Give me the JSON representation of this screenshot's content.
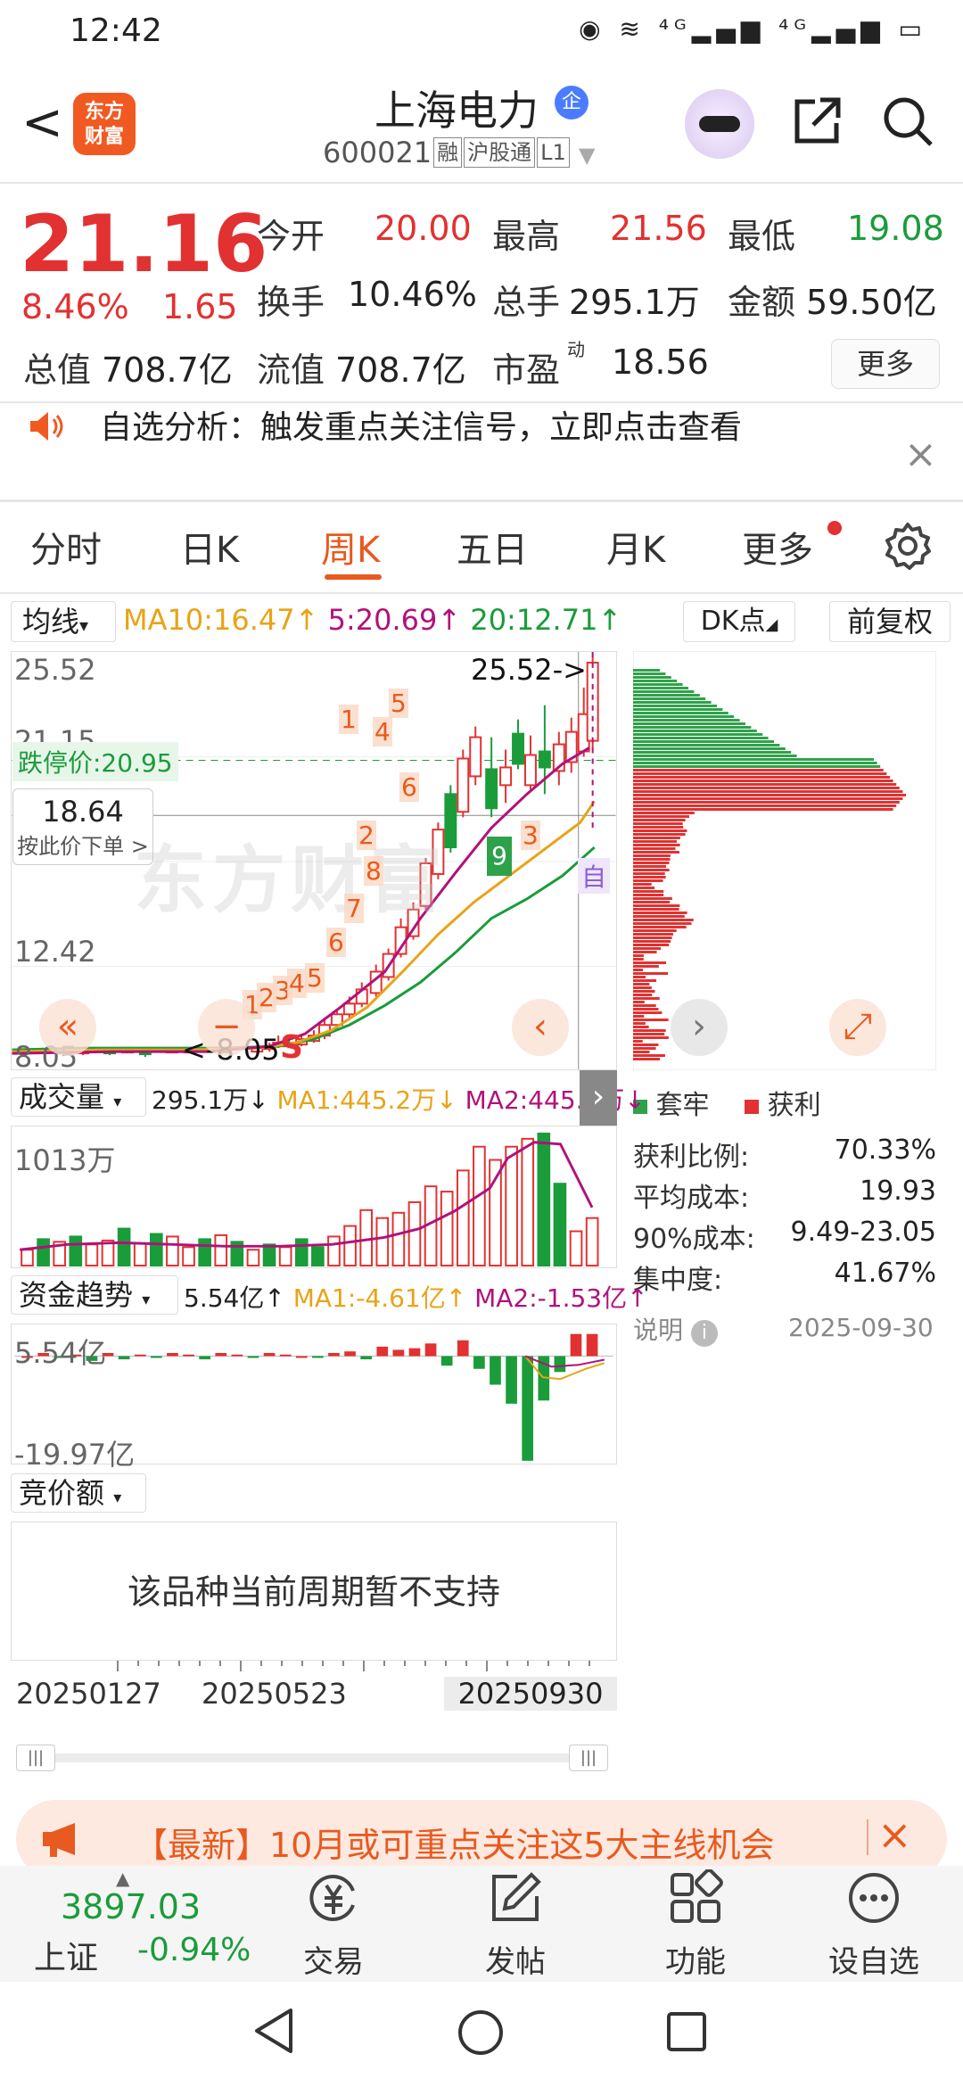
{
  "status": {
    "time": "12:42",
    "icons": "◉ ≋ ⁴ᴳ▂▄▆ ⁴ᴳ▂▄▆ ▭"
  },
  "header": {
    "back": "<",
    "logo": "东方\n财富",
    "title": "上海电力",
    "title_badge": "企",
    "code": "600021",
    "tags": [
      "融",
      "沪股通",
      "L1"
    ]
  },
  "quote": {
    "price": "21.16",
    "change_pct": "8.46%",
    "change_val": "1.65",
    "fields": [
      {
        "label": "今开",
        "value": "20.00",
        "color": "red"
      },
      {
        "label": "最高",
        "value": "21.56",
        "color": "red"
      },
      {
        "label": "最低",
        "value": "19.08",
        "color": "green"
      },
      {
        "label": "换手",
        "value": "10.46%",
        "color": "black"
      },
      {
        "label": "总手",
        "value": "295.1万",
        "color": "black"
      },
      {
        "label": "金额",
        "value": "59.50亿",
        "color": "black"
      },
      {
        "label": "总值",
        "value": "708.7亿",
        "color": "black"
      },
      {
        "label": "流值",
        "value": "708.7亿",
        "color": "black"
      },
      {
        "label": "市盈",
        "value": "18.56",
        "color": "black"
      }
    ],
    "pe_sup": "动",
    "more": "更多"
  },
  "notice": {
    "text": "自选分析：触发重点关注信号，立即点击查看",
    "close": "×"
  },
  "tabs": [
    "分时",
    "日K",
    "周K",
    "五日",
    "月K",
    "更多"
  ],
  "active_tab": "周K",
  "ma": {
    "select": "均线",
    "ma10": "MA10:16.47↑",
    "ma5": "5:20.69↑",
    "ma20": "20:12.71↑",
    "dk": "DK点",
    "fq": "前复权"
  },
  "kline": {
    "y_top": "25.52",
    "y_mid": "21.15",
    "y_low": "12.42",
    "y_bottom": "8.05",
    "high_mark": "25.52->",
    "low_mark": "<-8.05",
    "limit_label": "跌停价:20.95",
    "cursor_price": "18.64",
    "cursor_hint": "按此价下单 >",
    "watermark": "东方财富",
    "s_mark": "S",
    "self_mark": "自",
    "green_signal": "9",
    "numbers": [
      "1",
      "2",
      "3",
      "4",
      "5",
      "6",
      "7",
      "8",
      "1",
      "4",
      "5",
      "6",
      "2",
      "3"
    ]
  },
  "chips": {
    "legend_trapped": "套牢",
    "legend_profit": "获利",
    "rows": [
      {
        "label": "获利比例:",
        "value": "70.33%"
      },
      {
        "label": "平均成本:",
        "value": "19.93"
      },
      {
        "label": "90%成本:",
        "value": "9.49-23.05"
      },
      {
        "label": "集中度:",
        "value": "41.67%"
      }
    ],
    "explain": "说明",
    "date": "2025-09-30"
  },
  "volume": {
    "select": "成交量",
    "value": "295.1万↓",
    "ma1": "MA1:445.2万↓",
    "ma2": "MA2:445.2万↓",
    "y_label": "1013万",
    "bars": [
      0.12,
      0.2,
      0.18,
      0.22,
      0.16,
      0.19,
      0.28,
      0.17,
      0.24,
      0.22,
      0.14,
      0.2,
      0.23,
      0.18,
      0.12,
      0.16,
      0.14,
      0.2,
      0.14,
      0.22,
      0.3,
      0.42,
      0.36,
      0.4,
      0.48,
      0.6,
      0.56,
      0.72,
      0.9,
      0.8,
      0.9,
      0.96,
      1.0,
      0.62,
      0.26,
      0.36
    ],
    "up": [
      1,
      0,
      1,
      0,
      1,
      1,
      0,
      1,
      0,
      1,
      1,
      0,
      1,
      0,
      1,
      0,
      1,
      0,
      0,
      1,
      1,
      1,
      1,
      1,
      1,
      1,
      1,
      1,
      1,
      1,
      1,
      1,
      0,
      0,
      1,
      1
    ]
  },
  "fund": {
    "select": "资金趋势",
    "value": "5.54亿↑",
    "ma1": "MA1:-4.61亿↑",
    "ma2": "MA2:-1.53亿↑",
    "y_top": "5.54亿",
    "y_bottom": "-19.97亿"
  },
  "auction": {
    "select": "竞价额",
    "empty": "该品种当前周期暂不支持"
  },
  "xaxis": {
    "d1": "20250127",
    "d2": "20250523",
    "d3": "20250930"
  },
  "banner": {
    "text": "【最新】10月或可重点关注这5大主线机会",
    "close": "×"
  },
  "bottom_nav": {
    "index_value": "3897.03",
    "index_name": "上证",
    "index_change": "-0.94%",
    "items": [
      "交易",
      "发帖",
      "功能",
      "设自选"
    ]
  },
  "colors": {
    "red": "#e23131",
    "green": "#1a9c3a",
    "orange": "#e85a1f",
    "ma10": "#e8a317",
    "ma5": "#b0127a",
    "ma20": "#1a9c3a"
  }
}
